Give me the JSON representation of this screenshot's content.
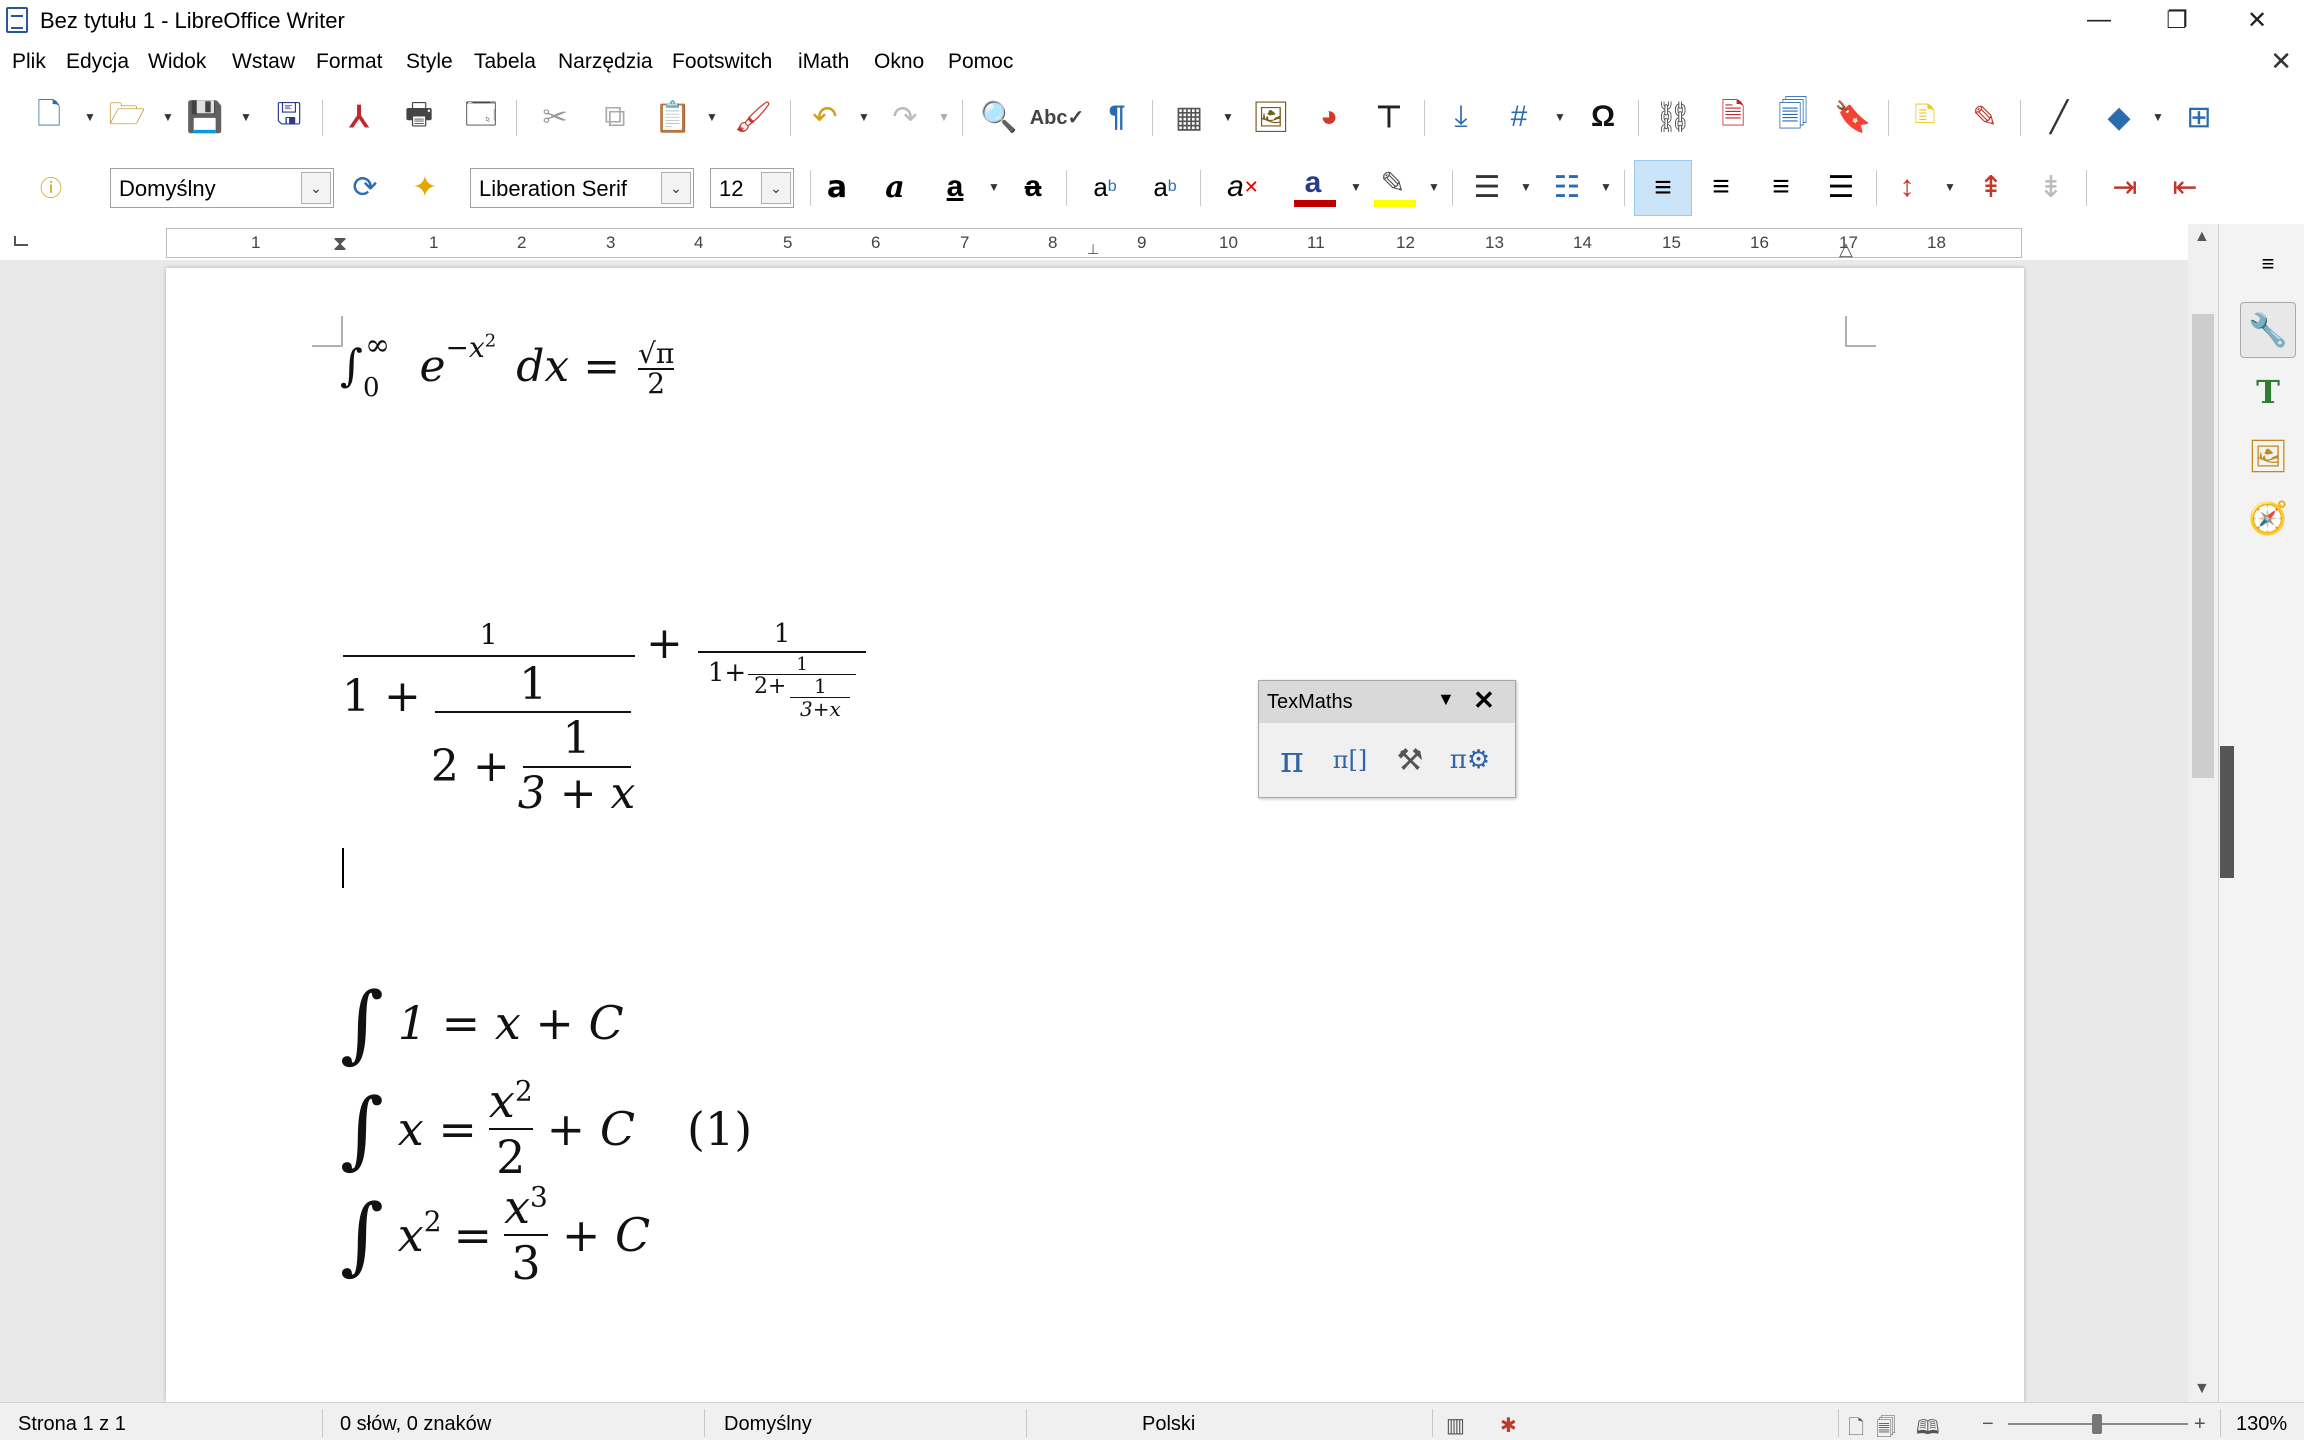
{
  "window": {
    "title": "Bez tytułu 1 - LibreOffice Writer",
    "controls": {
      "minimize": "—",
      "restore": "❐",
      "close": "✕"
    },
    "doc_close": "✕"
  },
  "menu": [
    "Plik",
    "Edycja",
    "Widok",
    "Wstaw",
    "Format",
    "Style",
    "Tabela",
    "Narzędzia",
    "Footswitch",
    "iMath",
    "Okno",
    "Pomoc"
  ],
  "toolbar_formatting": {
    "paragraph_style": "Domyślny",
    "font_name": "Liberation Serif",
    "font_size": "12",
    "colors": {
      "font_color": "#c00000",
      "highlight": "#ffff00"
    }
  },
  "ruler": {
    "labels": [
      "1",
      "1",
      "2",
      "3",
      "4",
      "5",
      "6",
      "7",
      "8",
      "9",
      "10",
      "11",
      "12",
      "13",
      "14",
      "15",
      "16",
      "17",
      "18"
    ]
  },
  "document": {
    "eq1": {
      "int": "∫",
      "lower": "0",
      "upper": "∞",
      "body": "e",
      "exp": "−x",
      "exp2": "2",
      "dx": "dx =",
      "sqrt": "√π",
      "den": "2"
    },
    "eq2": {
      "one": "1",
      "one_plus": "1 +",
      "two_plus": "2 +",
      "three_plus_x": "3 + x",
      "plus": "+",
      "small_one": "1",
      "small_one_plus": "1+",
      "small_two_plus": "2+",
      "small_three_plus_x": "3+x"
    },
    "eq3": [
      {
        "int": "∫",
        "body": "1 = x + C"
      },
      {
        "int": "∫",
        "left": "x =",
        "num": "x",
        "num_exp": "2",
        "den": "2",
        "right": "+ C",
        "tag": "(1)"
      },
      {
        "int": "∫",
        "left": "x",
        "left_exp": "2",
        "eq": "=",
        "num": "x",
        "num_exp": "3",
        "den": "3",
        "right": "+ C"
      }
    ]
  },
  "texmaths": {
    "title": "TexMaths",
    "buttons": [
      "π",
      "π[]",
      "⚒",
      "π⚙"
    ]
  },
  "status": {
    "page": "Strona 1 z 1",
    "words": "0 słów, 0 znaków",
    "style": "Domyślny",
    "language": "Polski",
    "zoom": "130%"
  },
  "icons": [
    "document-icon",
    "minimize-icon",
    "restore-icon",
    "close-icon",
    "new-icon",
    "open-icon",
    "save-icon",
    "pdf-icon",
    "print-icon",
    "preview-icon",
    "cut-icon",
    "copy-icon",
    "paste-icon",
    "clone-icon",
    "undo-icon",
    "redo-icon",
    "find-icon",
    "spellcheck-icon",
    "pilcrow-icon",
    "table-icon",
    "image-icon",
    "chart-icon",
    "textbox-icon",
    "pagebreak-icon",
    "field-icon",
    "omega-icon",
    "hyperlink-icon",
    "footnote-icon",
    "endnote-icon",
    "bookmark-icon",
    "comment-icon",
    "track-changes-icon",
    "line-icon",
    "shapes-icon",
    "basic-shapes-icon"
  ]
}
